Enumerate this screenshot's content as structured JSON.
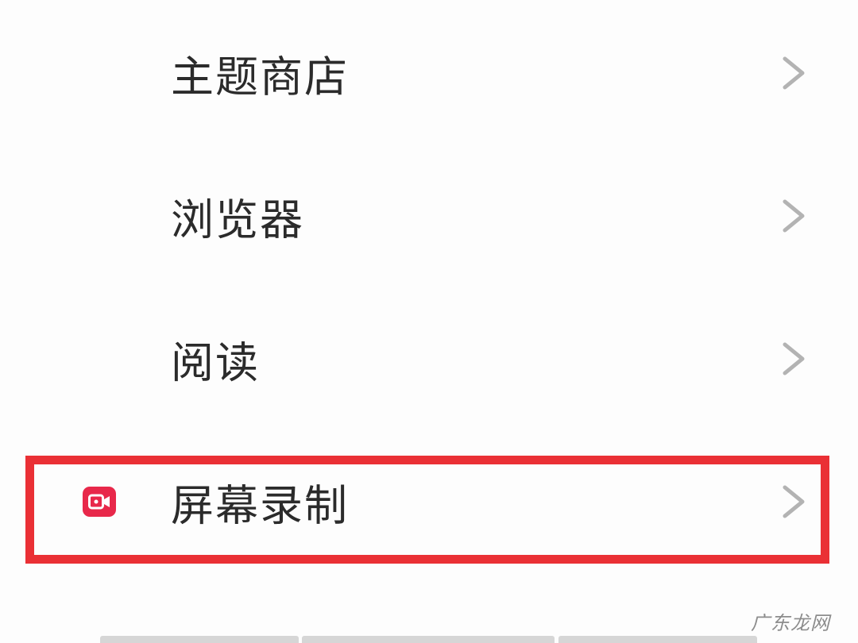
{
  "settings_menu": {
    "items": [
      {
        "label": "主题商店",
        "has_icon": false,
        "highlighted": false
      },
      {
        "label": "浏览器",
        "has_icon": false,
        "highlighted": false
      },
      {
        "label": "阅读",
        "has_icon": false,
        "highlighted": false
      },
      {
        "label": "屏幕录制",
        "has_icon": true,
        "icon": "screen-record-icon",
        "highlighted": true
      }
    ]
  },
  "colors": {
    "highlight_border": "#ea3035",
    "record_icon_bg": "#e8284a",
    "chevron": "#b3b3b3",
    "label_text": "#2b2b2b"
  },
  "icons": {
    "chevron": "chevron-right-icon",
    "screen_record": "screen-record-icon"
  },
  "watermark": {
    "text": "广东龙网"
  }
}
